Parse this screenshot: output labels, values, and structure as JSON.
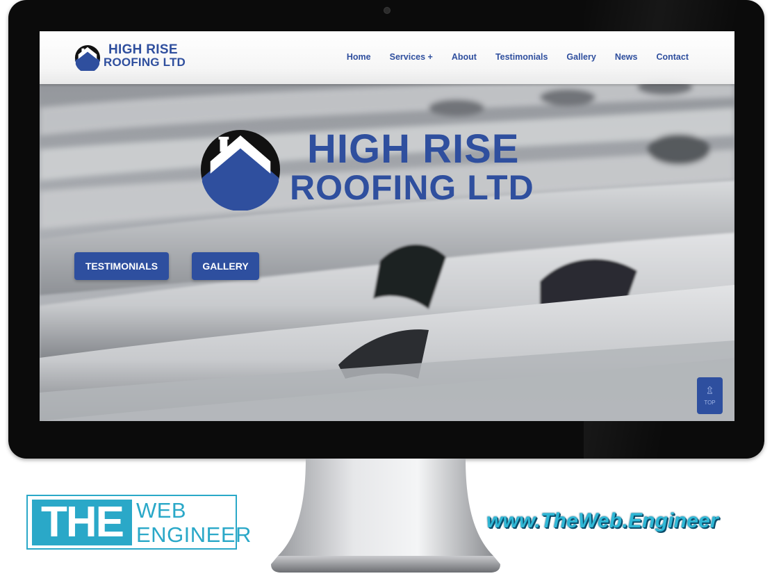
{
  "site": {
    "brand_line1": "HIGH RISE",
    "brand_line2": "ROOFING LTD"
  },
  "nav": {
    "items": [
      {
        "label": "Home"
      },
      {
        "label": "Services +"
      },
      {
        "label": "About"
      },
      {
        "label": "Testimonials"
      },
      {
        "label": "Gallery"
      },
      {
        "label": "News"
      },
      {
        "label": "Contact"
      }
    ]
  },
  "hero": {
    "title_line1": "HIGH RISE",
    "title_line2": "ROOFING LTD",
    "buttons": [
      {
        "label": "TESTIMONIALS"
      },
      {
        "label": "GALLERY"
      }
    ]
  },
  "back_to_top": {
    "icon": "arrow-up-icon",
    "label": "TOP"
  },
  "footer_brand": {
    "the": "THE",
    "web": "WEB",
    "engineer": "ENGINEER",
    "website": "www.TheWeb.Engineer"
  },
  "colors": {
    "brand_blue": "#2f4f9e",
    "accent_cyan": "#2aa8c8"
  }
}
